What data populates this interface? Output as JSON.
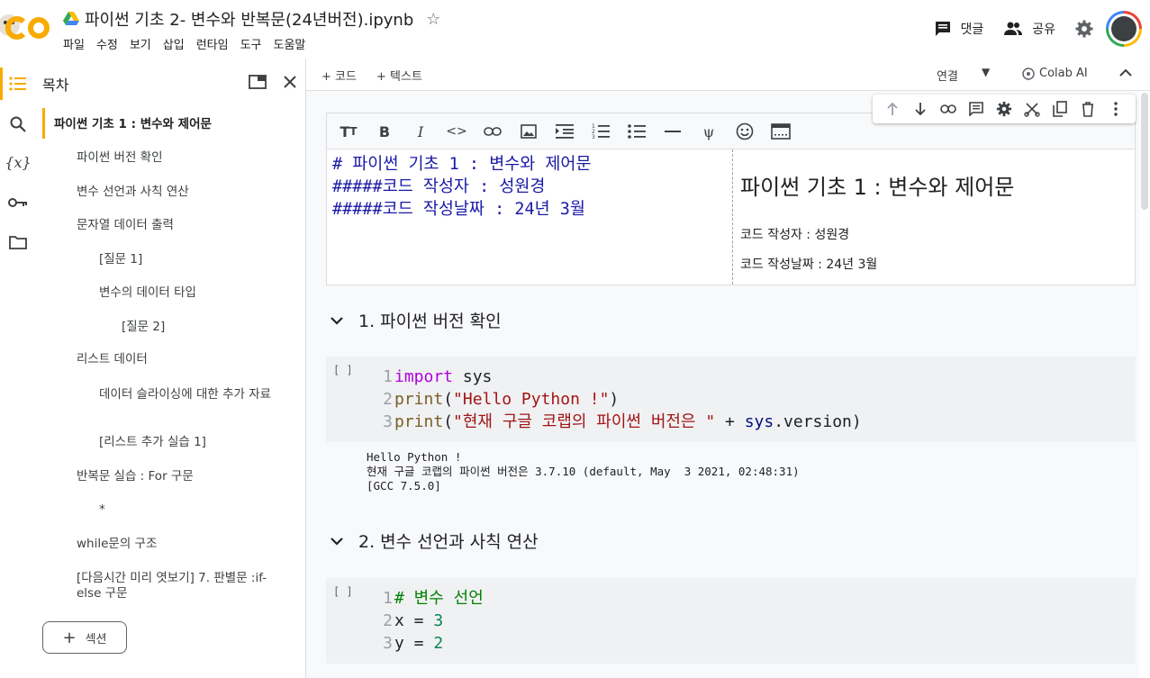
{
  "header": {
    "title": "파이썬 기초 2- 변수와 반복문(24년버전).ipynb",
    "menu": [
      "파일",
      "수정",
      "보기",
      "삽입",
      "런타임",
      "도구",
      "도움말"
    ],
    "comment_label": "댓글",
    "share_label": "공유"
  },
  "sidebar": {
    "toc_title": "목차",
    "items": [
      {
        "label": "파이썬 기초 1 : 변수와 제어문",
        "level": 1,
        "active": true
      },
      {
        "label": "파이썬 버전 확인",
        "level": 2
      },
      {
        "label": "변수 선언과 사칙 연산",
        "level": 2
      },
      {
        "label": "문자열 데이터 출력",
        "level": 2
      },
      {
        "label": "[질문 1]",
        "level": 3
      },
      {
        "label": "변수의 데이터 타입",
        "level": 3
      },
      {
        "label": "[질문 2]",
        "level": 4
      },
      {
        "label": "리스트 데이터",
        "level": 2
      },
      {
        "label": "데이터 슬라이싱에 대한 추가 자료",
        "level": 3
      },
      {
        "label": "[리스트 추가 실습 1]",
        "level": 3
      },
      {
        "label": "반복문 실습 : For 구문",
        "level": 2
      },
      {
        "label": "*",
        "level": 3
      },
      {
        "label": "while문의 구조",
        "level": 2
      },
      {
        "label": "[다음시간 미리 엿보기] 7. 판별문 :if-else 구문",
        "level": 2
      }
    ],
    "section_button": "섹션"
  },
  "toolbar": {
    "add_code": "코드",
    "add_text": "텍스트",
    "connect": "연결",
    "colab_ai": "Colab AI"
  },
  "text_cell": {
    "source": "# 파이썬 기초 1 : 변수와 제어문\n#####코드 작성자 : 성원경\n#####코드 작성날짜 : 24년 3월",
    "preview_title": "파이썬 기초 1 : 변수와 제어문",
    "preview_author": "코드 작성자 : 성원경",
    "preview_date": "코드 작성날짜 : 24년 3월"
  },
  "sections": [
    {
      "title": "1. 파이썬 버전 확인"
    },
    {
      "title": "2. 변수 선언과 사칙 연산"
    }
  ],
  "code_cells": [
    {
      "run_label": "[ ]",
      "lines": [
        [
          {
            "t": "import",
            "c": "kw"
          },
          {
            "t": " sys",
            "c": "plain"
          }
        ],
        [
          {
            "t": "print",
            "c": "fn"
          },
          {
            "t": "(",
            "c": "plain"
          },
          {
            "t": "\"Hello Python !\"",
            "c": "str"
          },
          {
            "t": ")",
            "c": "plain"
          }
        ],
        [
          {
            "t": "print",
            "c": "fn"
          },
          {
            "t": "(",
            "c": "plain"
          },
          {
            "t": "\"현재 구글 코랩의 파이썬 버전은 \"",
            "c": "str"
          },
          {
            "t": " + ",
            "c": "plain"
          },
          {
            "t": "sys",
            "c": "var"
          },
          {
            "t": ".version)",
            "c": "plain"
          }
        ]
      ],
      "output": "Hello Python !\n현재 구글 코랩의 파이썬 버전은 3.7.10 (default, May  3 2021, 02:48:31)\n[GCC 7.5.0]"
    },
    {
      "run_label": "[ ]",
      "lines": [
        [
          {
            "t": "# 변수 선언",
            "c": "cmt"
          }
        ],
        [
          {
            "t": "x = ",
            "c": "plain"
          },
          {
            "t": "3",
            "c": "num"
          }
        ],
        [
          {
            "t": "y = ",
            "c": "plain"
          },
          {
            "t": "2",
            "c": "num"
          }
        ]
      ]
    }
  ]
}
